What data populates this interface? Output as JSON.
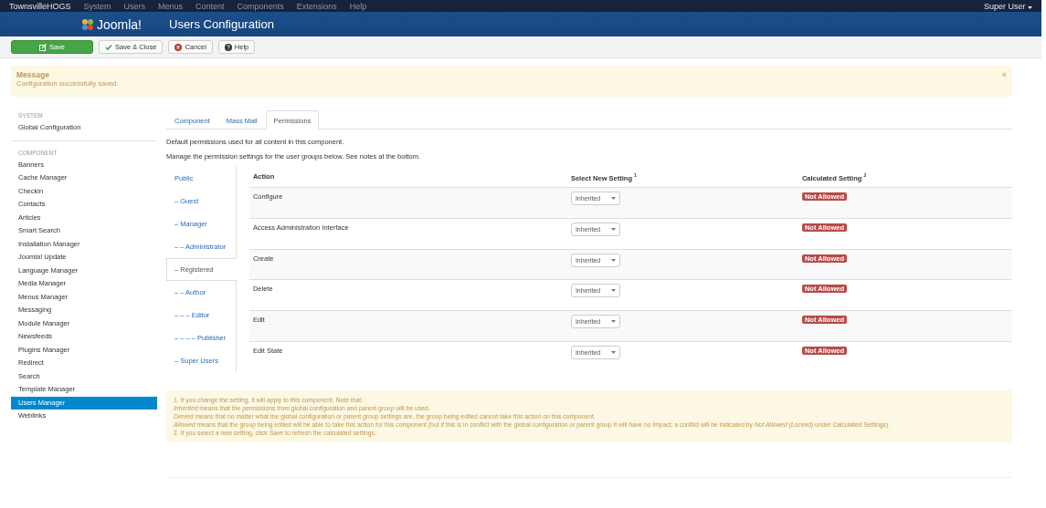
{
  "top_menu": {
    "site": "TownsvilleHOGS",
    "items": [
      "System",
      "Users",
      "Menus",
      "Content",
      "Components",
      "Extensions",
      "Help"
    ],
    "user": "Super User"
  },
  "header": {
    "logo": "Joomla!",
    "title": "Users Configuration"
  },
  "toolbar": [
    {
      "label": "Save",
      "kind": "primary"
    },
    {
      "label": "Save & Close",
      "kind": "check"
    },
    {
      "label": "Cancel",
      "kind": "cancel"
    },
    {
      "label": "Help",
      "kind": "help"
    }
  ],
  "message": {
    "title": "Message",
    "text": "Configuration successfully saved.",
    "close": "×"
  },
  "sidebar": {
    "sections": [
      {
        "heading": "SYSTEM",
        "items": [
          {
            "label": "Global Configuration",
            "selected": false
          }
        ]
      },
      {
        "heading": "COMPONENT",
        "items": [
          {
            "label": "Banners",
            "selected": false
          },
          {
            "label": "Cache Manager",
            "selected": false
          },
          {
            "label": "Checkin",
            "selected": false
          },
          {
            "label": "Contacts",
            "selected": false
          },
          {
            "label": "Articles",
            "selected": false
          },
          {
            "label": "Smart Search",
            "selected": false
          },
          {
            "label": "Installation Manager",
            "selected": false
          },
          {
            "label": "Joomla! Update",
            "selected": false
          },
          {
            "label": "Language Manager",
            "selected": false
          },
          {
            "label": "Media Manager",
            "selected": false
          },
          {
            "label": "Menus Manager",
            "selected": false
          },
          {
            "label": "Messaging",
            "selected": false
          },
          {
            "label": "Module Manager",
            "selected": false
          },
          {
            "label": "Newsfeeds",
            "selected": false
          },
          {
            "label": "Plugins Manager",
            "selected": false
          },
          {
            "label": "Redirect",
            "selected": false
          },
          {
            "label": "Search",
            "selected": false
          },
          {
            "label": "Template Manager",
            "selected": false
          },
          {
            "label": "Users Manager",
            "selected": true
          },
          {
            "label": "Weblinks",
            "selected": false
          }
        ]
      }
    ]
  },
  "tabs": [
    {
      "label": "Component",
      "selected": false
    },
    {
      "label": "Mass Mail",
      "selected": false
    },
    {
      "label": "Permissions",
      "selected": true
    }
  ],
  "intro": [
    "Default permissions used for all content in this component.",
    "Manage the permission settings for the user groups below. See notes at the bottom."
  ],
  "groups": [
    {
      "label": "Public",
      "selected": false
    },
    {
      "label": "– Guest",
      "selected": false
    },
    {
      "label": "– Manager",
      "selected": false
    },
    {
      "label": "– – Administrator",
      "selected": false
    },
    {
      "label": "– Registered",
      "selected": true
    },
    {
      "label": "– – Author",
      "selected": false
    },
    {
      "label": "– – – Editor",
      "selected": false
    },
    {
      "label": "– – – – Publisher",
      "selected": false
    },
    {
      "label": "– Super Users",
      "selected": false
    }
  ],
  "table": {
    "columns": [
      "Action",
      "Select New Setting $^{1}$",
      "Calculated Setting $^{2}$"
    ],
    "rows": [
      {
        "action": "Configure",
        "setting": "Inherited",
        "calculated": "Not Allowed"
      },
      {
        "action": "Access Administration Interface",
        "setting": "Inherited",
        "calculated": "Not Allowed"
      },
      {
        "action": "Create",
        "setting": "Inherited",
        "calculated": "Not Allowed"
      },
      {
        "action": "Delete",
        "setting": "Inherited",
        "calculated": "Not Allowed"
      },
      {
        "action": "Edit",
        "setting": "Inherited",
        "calculated": "Not Allowed"
      },
      {
        "action": "Edit State",
        "setting": "Inherited",
        "calculated": "Not Allowed"
      }
    ]
  },
  "notes": [
    "1. If you change the setting, it will apply to this component. Note that:",
    "*Inherited* means that the permissions from global configuration and parent group will be used.",
    "*Denied* means that no matter what the global configuration or parent group settings are, the group being edited cannot take this action on this component.",
    "*Allowed* means that the group being edited will be able to take this action for this component (but if this is in conflict with the global configuration or parent group it will have no impact; a conflict will be indicated by *Not Allowed (Locked)* under Calculated Settings).",
    "2. If you select a new setting, click *Save* to refresh the calculated settings."
  ]
}
